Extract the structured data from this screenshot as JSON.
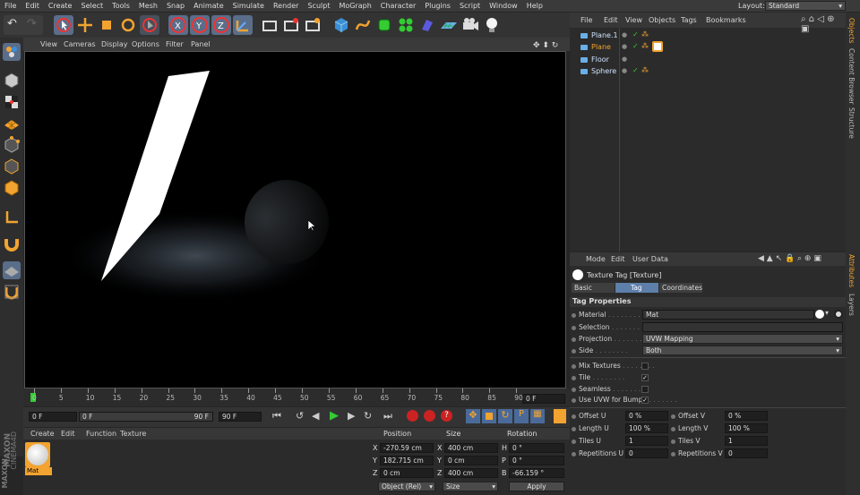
{
  "menubar": {
    "items": [
      "File",
      "Edit",
      "Create",
      "Select",
      "Tools",
      "Mesh",
      "Snap",
      "Animate",
      "Simulate",
      "Render",
      "Sculpt",
      "MoGraph",
      "Character",
      "Plugins",
      "Script",
      "Window",
      "Help"
    ],
    "layout_label": "Layout:",
    "layout_value": "Standard"
  },
  "viewport": {
    "menu": [
      "View",
      "Cameras",
      "Display",
      "Options",
      "Filter",
      "Panel"
    ]
  },
  "timeline": {
    "ticks": [
      "0",
      "5",
      "10",
      "15",
      "20",
      "25",
      "30",
      "35",
      "40",
      "45",
      "50",
      "55",
      "60",
      "65",
      "70",
      "75",
      "80",
      "85",
      "90"
    ],
    "current_frame": "0 F"
  },
  "playbar": {
    "start": "0 F",
    "range_start": "0 F",
    "range_end": "90 F",
    "end": "90 F"
  },
  "materials": {
    "menu": [
      "Create",
      "Edit",
      "Function",
      "Texture"
    ],
    "mat_name": "Mat",
    "brand1": "MAXON",
    "brand2": "CINEMA4D"
  },
  "coordinates": {
    "headers": [
      "Position",
      "Size",
      "Rotation"
    ],
    "rows": [
      {
        "axis": "X",
        "pos": "-270.59 cm",
        "saxis": "X",
        "size": "400 cm",
        "raxis": "H",
        "rot": "0 °"
      },
      {
        "axis": "Y",
        "pos": "182.715 cm",
        "saxis": "Y",
        "size": "0 cm",
        "raxis": "P",
        "rot": "0 °"
      },
      {
        "axis": "Z",
        "pos": "0 cm",
        "saxis": "Z",
        "size": "400 cm",
        "raxis": "B",
        "rot": "-66.159 °"
      }
    ],
    "mode": "Object (Rel)",
    "size_mode": "Size",
    "apply": "Apply"
  },
  "objects": {
    "menu": [
      "File",
      "Edit",
      "View",
      "Objects",
      "Tags",
      "Bookmarks"
    ],
    "items": [
      {
        "name": "Plane.1",
        "color": "#cfe3ff"
      },
      {
        "name": "Plane",
        "color": "#f2a330"
      },
      {
        "name": "Floor",
        "color": "#cfe3ff"
      },
      {
        "name": "Sphere",
        "color": "#cfe3ff"
      }
    ]
  },
  "attributes": {
    "menu": [
      "Mode",
      "Edit",
      "User Data"
    ],
    "title": "Texture Tag [Texture]",
    "tabs": [
      "Basic",
      "Tag",
      "Coordinates"
    ],
    "section": "Tag Properties",
    "material_label": "Material",
    "material_value": "Mat",
    "selection_label": "Selection",
    "projection_label": "Projection",
    "projection_value": "UVW Mapping",
    "side_label": "Side",
    "side_value": "Both",
    "mix_label": "Mix Textures",
    "tile_label": "Tile",
    "seamless_label": "Seamless",
    "uvw_bump_label": "Use UVW for Bump",
    "offset_u_label": "Offset U",
    "offset_u": "0 %",
    "offset_v_label": "Offset V",
    "offset_v": "0 %",
    "length_u_label": "Length U",
    "length_u": "100 %",
    "length_v_label": "Length V",
    "length_v": "100 %",
    "tiles_u_label": "Tiles U",
    "tiles_u": "1",
    "tiles_v_label": "Tiles V",
    "tiles_v": "1",
    "rep_u_label": "Repetitions U",
    "rep_u": "0",
    "rep_v_label": "Repetitions V",
    "rep_v": "0"
  },
  "side_tabs": [
    "Objects",
    "Content Browser",
    "Structure"
  ],
  "side_tabs2": [
    "Attributes",
    "Layers"
  ]
}
